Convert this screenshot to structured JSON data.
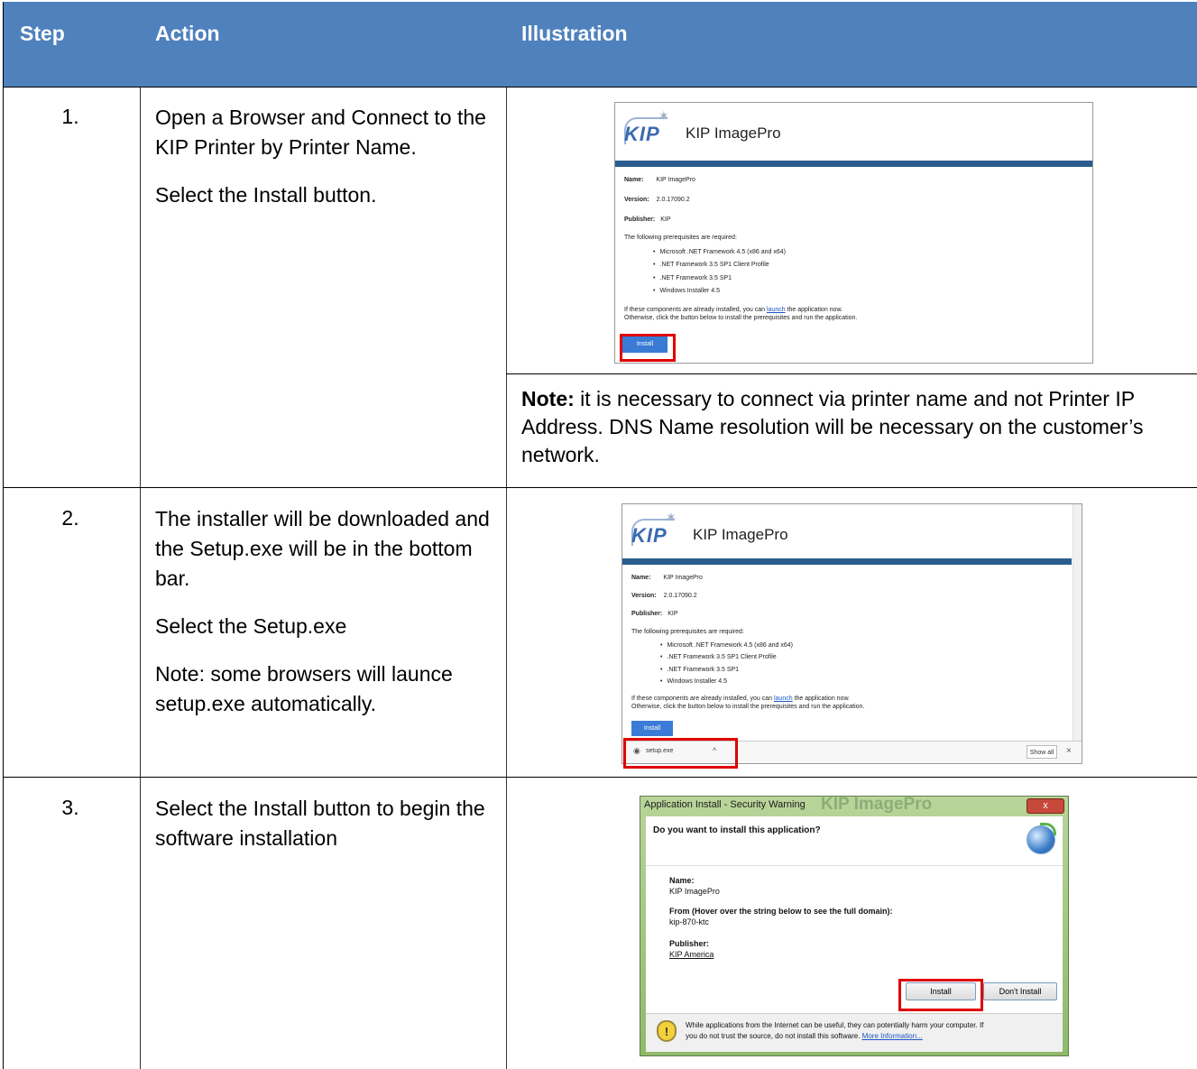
{
  "table": {
    "headers": [
      "Step",
      "Action",
      "Illustration"
    ],
    "rows": [
      {
        "step": "1.",
        "action": [
          "Open a Browser and Connect to the KIP Printer by Printer Name.",
          "Select the Install button."
        ],
        "note_label": "Note:",
        "note_text": " it is necessary to connect via printer name and not Printer IP Address. DNS Name resolution will be necessary on the customer’s network."
      },
      {
        "step": "2.",
        "action": [
          "The installer will be downloaded and the Setup.exe will be in the bottom bar.",
          "Select the Setup.exe",
          "Note: some browsers will launce setup.exe automatically."
        ]
      },
      {
        "step": "3.",
        "action": [
          "Select the Install button to begin the software installation"
        ]
      }
    ]
  },
  "kip_page": {
    "logo": "KIP",
    "app_title": "KIP ImagePro",
    "name_label": "Name:",
    "name_value": "KIP ImagePro",
    "version_label": "Version:",
    "version_value": "2.0.17090.2",
    "publisher_label": "Publisher:",
    "publisher_value": "KIP",
    "prereq_intro": "The following prerequisites are required:",
    "prereqs": [
      "Microsoft .NET Framework 4.5 (x86 and x64)",
      ".NET Framework 3.5 SP1 Client Profile",
      ".NET Framework 3.5 SP1",
      "Windows Installer 4.5"
    ],
    "launch_pre": "If these components are already installed, you can ",
    "launch_link": "launch",
    "launch_post": " the application now.",
    "otherwise": "Otherwise, click the button below to install the prerequisites and run the application.",
    "install_label": "Install"
  },
  "download_bar": {
    "file": "setup.exe",
    "show_all": "Show all",
    "close": "×"
  },
  "security_dialog": {
    "title": "Application Install - Security Warning",
    "title_bg": "KIP ImagePro",
    "close": "x",
    "question": "Do you want to install this application?",
    "name_label": "Name:",
    "name_value": "KIP ImagePro",
    "from_label": "From (Hover over the string below to see the full domain):",
    "from_value": "kip-870-ktc",
    "publisher_label": "Publisher:",
    "publisher_value": "KIP America",
    "install_label": "Install",
    "dont_install_label": "Don't Install",
    "warning_line1": "While applications from the Internet can be useful, they can potentially harm your computer. If",
    "warning_line2_pre": "you do not trust the source, do not install this software. ",
    "warning_link": "More Information..."
  },
  "colors": {
    "header_bg": "#4f81bd",
    "highlight": "#e00000",
    "kip_blue": "#2a5d8e"
  }
}
